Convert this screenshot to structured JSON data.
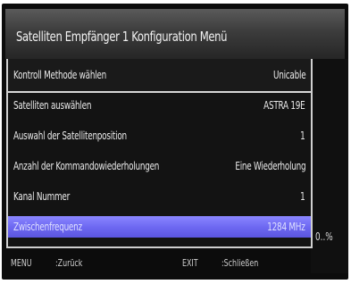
{
  "window": {
    "title": "Satelliten Empfänger 1 Konfiguration Menü"
  },
  "menu": {
    "header": {
      "label": "Kontroll Methode wählen",
      "value": "Unicable"
    },
    "items": [
      {
        "label": "Satelliten auswählen",
        "value": "ASTRA 19E"
      },
      {
        "label": "Auswahl der Satellitenposition",
        "value": "1"
      },
      {
        "label": "Anzahl der Kommandowiederholungen",
        "value": "Eine Wiederholung"
      },
      {
        "label": "Kanal Nummer",
        "value": "1"
      },
      {
        "label": "Zwischenfrequenz",
        "value": "1284 MHz",
        "selected": true
      }
    ]
  },
  "side_indicator": "0..%",
  "footer": {
    "menu_key": "MENU",
    "menu_action": ":Zurück",
    "exit_key": "EXIT",
    "exit_action": ":Schließen"
  },
  "colors": {
    "selection": "#6e69f2",
    "background": "#0c0c0c",
    "text": "#e9e9e9"
  }
}
